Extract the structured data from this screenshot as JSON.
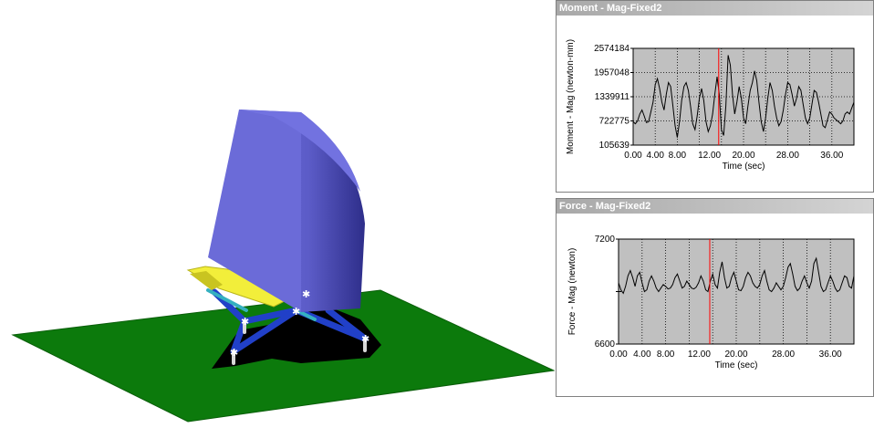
{
  "model_view": {
    "ground_color": "#0c7a0c",
    "shell_color": "#6a6ad6",
    "platform_color": "#f2ee3a",
    "strut_color": "#2a4ad0"
  },
  "charts": {
    "moment": {
      "title": "Moment - Mag-Fixed2",
      "chart_data": {
        "type": "line",
        "ylabel": "Moment - Mag (newton-mm)",
        "xlabel": "Time (sec)",
        "y_ticks": [
          "2574184",
          "1957048",
          "1339911",
          "722775",
          "105639"
        ],
        "x_ticks": [
          "0.00",
          "4.00",
          "8.00",
          "12.00",
          "20.00",
          "28.00",
          "36.00"
        ],
        "xlim": [
          0,
          40
        ],
        "ylim": [
          105639,
          2574184
        ],
        "grid": true,
        "background": "#c0c0c0",
        "cursor_x": 15.5,
        "cursor_color": "#ff0000",
        "x": [
          0,
          0.4,
          0.8,
          1.2,
          1.6,
          2.0,
          2.4,
          2.8,
          3.2,
          3.6,
          4.0,
          4.4,
          4.8,
          5.2,
          5.6,
          6.0,
          6.4,
          6.8,
          7.2,
          7.6,
          8.0,
          8.4,
          8.8,
          9.2,
          9.6,
          10.0,
          10.4,
          10.8,
          11.2,
          11.6,
          12.0,
          12.4,
          12.8,
          13.2,
          13.6,
          14.0,
          14.4,
          14.8,
          15.2,
          15.6,
          16.0,
          16.4,
          16.8,
          17.2,
          17.6,
          18.0,
          18.4,
          18.8,
          19.2,
          19.6,
          20.0,
          20.4,
          20.8,
          21.2,
          21.6,
          22.0,
          22.4,
          22.8,
          23.2,
          23.6,
          24.0,
          24.4,
          24.8,
          25.2,
          25.6,
          26.0,
          26.4,
          26.8,
          27.2,
          27.6,
          28.0,
          28.4,
          28.8,
          29.2,
          29.6,
          30.0,
          30.4,
          30.8,
          31.2,
          31.6,
          32.0,
          32.4,
          32.8,
          33.2,
          33.6,
          34.0,
          34.4,
          34.8,
          35.2,
          35.6,
          36.0,
          36.4,
          36.8,
          37.2,
          37.6,
          38.0,
          38.4,
          38.8,
          39.2,
          39.6,
          40.0
        ],
        "values": [
          700000,
          650000,
          720000,
          900000,
          1000000,
          850000,
          680000,
          700000,
          950000,
          1200000,
          1650000,
          1800000,
          1550000,
          1200000,
          1000000,
          1400000,
          1700000,
          1600000,
          1100000,
          600000,
          300000,
          700000,
          1250000,
          1600000,
          1700000,
          1500000,
          1100000,
          650000,
          500000,
          850000,
          1300000,
          1550000,
          1250000,
          700000,
          450000,
          600000,
          900000,
          1400000,
          1850000,
          1400000,
          500000,
          350000,
          1100000,
          2400000,
          2150000,
          1400000,
          900000,
          1200000,
          1600000,
          1300000,
          800000,
          650000,
          1100000,
          1500000,
          1700000,
          2000000,
          1750000,
          1200000,
          700000,
          450000,
          800000,
          1300000,
          1700000,
          1500000,
          1100000,
          800000,
          600000,
          700000,
          1000000,
          1400000,
          1700000,
          1650000,
          1400000,
          1100000,
          1300000,
          1600000,
          1500000,
          1150000,
          800000,
          650000,
          800000,
          1150000,
          1500000,
          1450000,
          1200000,
          900000,
          600000,
          550000,
          750000,
          950000,
          900000,
          800000,
          750000,
          700000,
          650000,
          720000,
          900000,
          950000,
          900000,
          1050000,
          1200000
        ]
      }
    },
    "force": {
      "title": "Force - Mag-Fixed2",
      "chart_data": {
        "type": "line",
        "ylabel": "Force - Mag (newton)",
        "xlabel": "Time (sec)",
        "y_ticks": [
          "7200",
          "6600"
        ],
        "x_ticks": [
          "0.00",
          "4.00",
          "8.00",
          "12.00",
          "20.00",
          "28.00",
          "36.00"
        ],
        "xlim": [
          0,
          40
        ],
        "ylim": [
          6600,
          7200
        ],
        "grid": true,
        "background": "#c0c0c0",
        "cursor_x": 15.5,
        "cursor_color": "#ff0000",
        "x": [
          0,
          0.4,
          0.8,
          1.2,
          1.6,
          2.0,
          2.4,
          2.8,
          3.2,
          3.6,
          4.0,
          4.4,
          4.8,
          5.2,
          5.6,
          6.0,
          6.4,
          6.8,
          7.2,
          7.6,
          8.0,
          8.4,
          8.8,
          9.2,
          9.6,
          10.0,
          10.4,
          10.8,
          11.2,
          11.6,
          12.0,
          12.4,
          12.8,
          13.2,
          13.6,
          14.0,
          14.4,
          14.8,
          15.2,
          15.6,
          16.0,
          16.4,
          16.8,
          17.2,
          17.6,
          18.0,
          18.4,
          18.8,
          19.2,
          19.6,
          20.0,
          20.4,
          20.8,
          21.2,
          21.6,
          22.0,
          22.4,
          22.8,
          23.2,
          23.6,
          24.0,
          24.4,
          24.8,
          25.2,
          25.6,
          26.0,
          26.4,
          26.8,
          27.2,
          27.6,
          28.0,
          28.4,
          28.8,
          29.2,
          29.6,
          30.0,
          30.4,
          30.8,
          31.2,
          31.6,
          32.0,
          32.4,
          32.8,
          33.2,
          33.6,
          34.0,
          34.4,
          34.8,
          35.2,
          35.6,
          36.0,
          36.4,
          36.8,
          37.2,
          37.6,
          38.0,
          38.4,
          38.8,
          39.2,
          39.6,
          40.0
        ],
        "values": [
          6950,
          6910,
          6890,
          6930,
          6990,
          7020,
          6980,
          6930,
          6990,
          7010,
          6950,
          6900,
          6910,
          6960,
          6990,
          6960,
          6920,
          6900,
          6920,
          6940,
          6930,
          6915,
          6920,
          6940,
          6980,
          7000,
          6960,
          6920,
          6930,
          6960,
          6940,
          6920,
          6915,
          6925,
          6950,
          6990,
          6960,
          6910,
          6900,
          6960,
          7000,
          6940,
          6920,
          7010,
          7070,
          6980,
          6920,
          6930,
          6980,
          7010,
          6960,
          6910,
          6905,
          6930,
          6980,
          7010,
          6990,
          6950,
          6930,
          6920,
          6940,
          6990,
          7020,
          6960,
          6910,
          6900,
          6920,
          6950,
          6930,
          6910,
          6930,
          6980,
          7040,
          7060,
          7000,
          6930,
          6905,
          6920,
          6960,
          6990,
          6950,
          6920,
          6960,
          7060,
          7090,
          7010,
          6930,
          6900,
          6910,
          6950,
          6990,
          6960,
          6920,
          6900,
          6910,
          6950,
          6990,
          6980,
          6930,
          6920,
          6990
        ]
      }
    }
  }
}
